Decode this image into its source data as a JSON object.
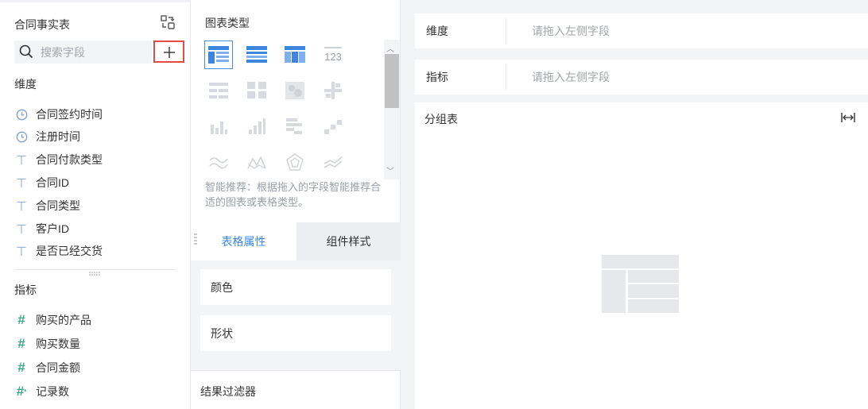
{
  "fields_panel": {
    "table_name": "合同事实表",
    "search_placeholder": "搜索字段",
    "dimension_title": "维度",
    "dimensions": [
      {
        "label": "合同签约时间",
        "icon": "clock-icon"
      },
      {
        "label": "注册时间",
        "icon": "clock-icon"
      },
      {
        "label": "合同付款类型",
        "icon": "text-type-icon"
      },
      {
        "label": "合同ID",
        "icon": "text-type-icon"
      },
      {
        "label": "合同类型",
        "icon": "text-type-icon"
      },
      {
        "label": "客户ID",
        "icon": "text-type-icon"
      },
      {
        "label": "是否已经交货",
        "icon": "text-type-icon"
      }
    ],
    "metric_title": "指标",
    "metrics": [
      {
        "label": "购买的产品",
        "icon": "hash-icon"
      },
      {
        "label": "购买数量",
        "icon": "hash-icon"
      },
      {
        "label": "合同金额",
        "icon": "hash-icon"
      },
      {
        "label": "记录数",
        "icon": "hash-star-icon"
      }
    ]
  },
  "chart_panel": {
    "title": "图表类型",
    "tip": "智能推荐：根据拖入的字段智能推荐合适的图表或表格类型。",
    "tabs": {
      "table_props": "表格属性",
      "component_style": "组件样式"
    },
    "props": {
      "color": "颜色",
      "shape": "形状"
    },
    "filter_title": "结果过滤器",
    "number_chart_text": "123"
  },
  "canvas": {
    "dimension_label": "维度",
    "dimension_placeholder": "请拖入左侧字段",
    "metric_label": "指标",
    "metric_placeholder": "请拖入左侧字段",
    "preview_title": "分组表"
  },
  "colors": {
    "accent": "#3d86e0",
    "highlight_border": "#e14b4b",
    "hash_icon": "#3aa68a",
    "dim_icon": "#7a9ed6"
  }
}
